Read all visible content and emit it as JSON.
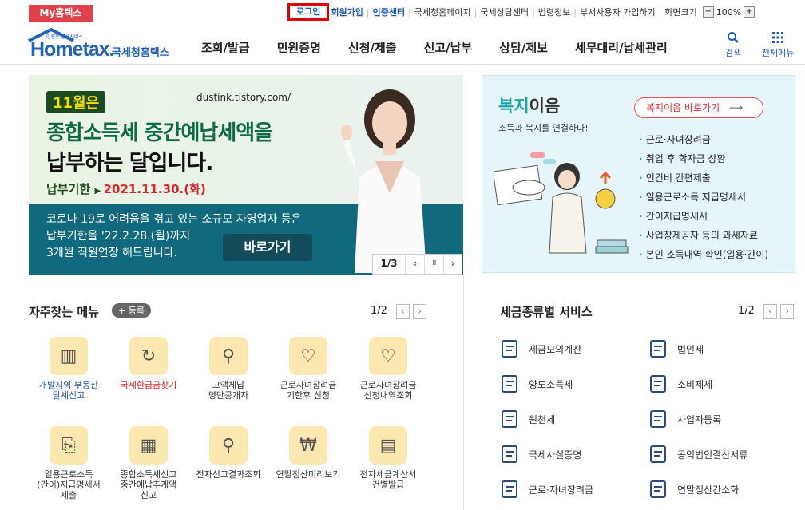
{
  "topbar": {
    "my_home": "My홈택스",
    "login": "로그인",
    "signup": "회원가입",
    "cert_center": "인증센터",
    "links": [
      "국세청홈페이지",
      "국세상담센터",
      "법령정보",
      "부서사용자 가입하기",
      "화면크기"
    ],
    "zoom_minus": "−",
    "zoom_level": "100%",
    "zoom_plus": "+"
  },
  "header": {
    "logo_small": "민원은 날세서비스",
    "logo_word": "Hometax.",
    "logo_sub": "국세청홈택스",
    "gnb": [
      "조회/발급",
      "민원증명",
      "신청/제출",
      "신고/납부",
      "상담/제보",
      "세무대리/납세관리"
    ],
    "search_label": "검색",
    "allmenu_label": "전체메뉴"
  },
  "banner": {
    "badge": "11월은",
    "url": "dustink.tistory.com/",
    "headline_1": "종합소득세 중간예납세액을",
    "headline_2": "납부하는 달입니다.",
    "deadline_label": "납부기한",
    "deadline_date": "2021.11.30.(화)",
    "notice_1": "코로나 19로 어려움을 겪고 있는 소규모 자영업자 등은",
    "notice_2": "납부기한을 '22.2.28.(월)까지",
    "notice_3": "3개월 직원연장 해드립니다.",
    "go_label": "바로가기",
    "pager": "1/3",
    "prev": "‹",
    "pause": "॥",
    "next": "›"
  },
  "welfare": {
    "title_a": "복지",
    "title_b": "이음",
    "subtitle": "소득과 복지를 연결하다!",
    "go_label": "복지이음 바로가기",
    "items": [
      "근로·자녀장려금",
      "취업 후 학자금 상환",
      "인건비 간편제출",
      "일용근로소득 지급명세서",
      "간이지급명세서",
      "사업장제공자 등의 과세자료",
      "본인 소득내역 확인(일용·간이)"
    ]
  },
  "favorites": {
    "title": "자주찾는 메뉴",
    "add_label": "+ 등록",
    "page": "1/2",
    "items": [
      {
        "label": "개발지역 부동산\n탈세신고",
        "color": "#1f5ab0"
      },
      {
        "label": "국세환급금찾기",
        "color": "#d8262b"
      },
      {
        "label": "고액체납\n명단공개자",
        "color": "#333333"
      },
      {
        "label": "근로자녀장려금\n기한후 신청",
        "color": "#333333"
      },
      {
        "label": "근로자녀장려금\n신청내역조회",
        "color": "#333333"
      },
      {
        "label": "일용근로소득\n(간이)지급명세서\n제출",
        "color": "#333333"
      },
      {
        "label": "종합소득세신고\n중간예납추계액\n신고",
        "color": "#333333"
      },
      {
        "label": "전자신고결과조회",
        "color": "#333333"
      },
      {
        "label": "연말정산미리보기",
        "color": "#333333"
      },
      {
        "label": "전자세금계산서\n건별발급",
        "color": "#333333"
      }
    ]
  },
  "tax_services": {
    "title": "세금종류별 서비스",
    "page": "1/2",
    "items": [
      "세금모의계산",
      "법인세",
      "양도소득세",
      "소비제세",
      "원천세",
      "사업자등록",
      "국세사실증명",
      "공익법인결산서류",
      "근로·자녀장려금",
      "연말정산간소화"
    ]
  }
}
